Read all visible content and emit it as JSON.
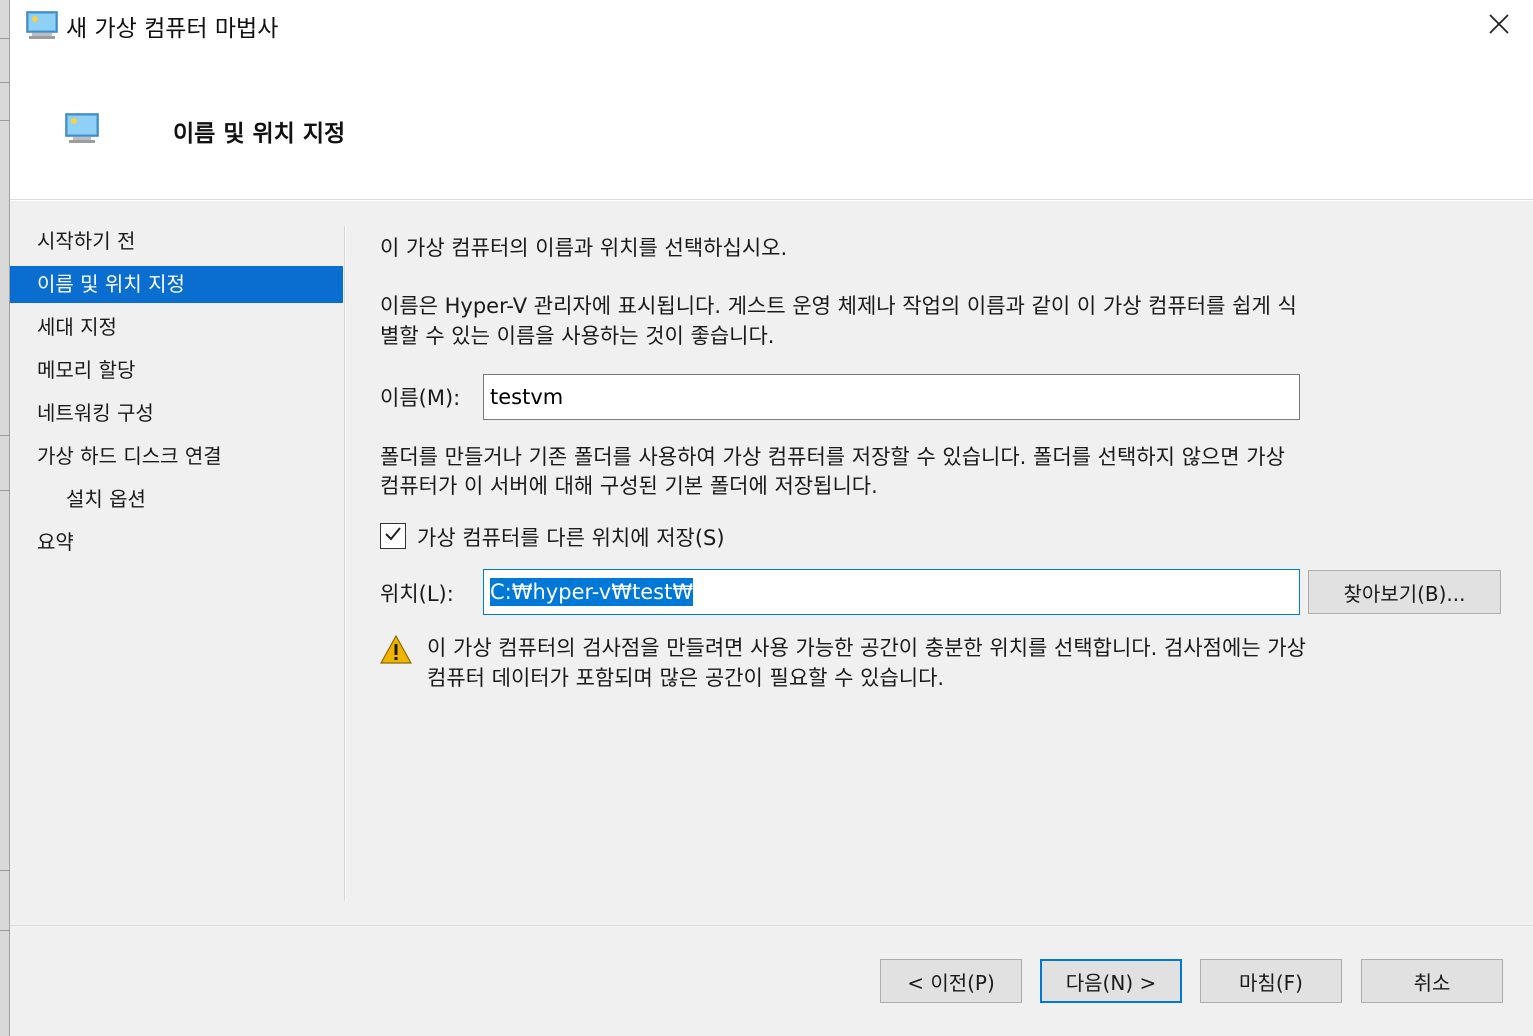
{
  "window": {
    "title": "새 가상 컴퓨터 마법사",
    "close_icon": "close-icon"
  },
  "header": {
    "title": "이름 및 위치 지정",
    "icon": "virtual-machine-icon"
  },
  "nav": {
    "items": [
      {
        "label": "시작하기 전"
      },
      {
        "label": "이름 및 위치 지정"
      },
      {
        "label": "세대 지정"
      },
      {
        "label": "메모리 할당"
      },
      {
        "label": "네트워킹 구성"
      },
      {
        "label": "가상 하드 디스크 연결"
      },
      {
        "label": "설치 옵션"
      },
      {
        "label": "요약"
      }
    ],
    "active_index": 1
  },
  "content": {
    "intro": "이 가상 컴퓨터의 이름과 위치를 선택하십시오.",
    "name_desc_line1": "이름은 Hyper-V 관리자에 표시됩니다. 게스트 운영 체제나 작업의 이름과 같이 이 가상 컴퓨터를 쉽게 식",
    "name_desc_line2": "별할 수 있는 이름을 사용하는 것이 좋습니다.",
    "name_label": "이름(M):",
    "name_value": "testvm",
    "folder_desc_line1": "폴더를 만들거나 기존 폴더를 사용하여 가상 컴퓨터를 저장할 수 있습니다. 폴더를 선택하지 않으면 가상",
    "folder_desc_line2": "컴퓨터가 이 서버에 대해 구성된 기본 폴더에 저장됩니다.",
    "store_checkbox_label": "가상 컴퓨터를 다른 위치에 저장(S)",
    "store_checked": true,
    "location_label": "위치(L):",
    "location_value": "C:₩hyper-v₩test₩",
    "browse_label": "찾아보기(B)...",
    "warning_line1": "이 가상 컴퓨터의 검사점을 만들려면 사용 가능한 공간이 충분한 위치를 선택합니다. 검사점에는 가상",
    "warning_line2": "컴퓨터 데이터가 포함되며 많은 공간이 필요할 수 있습니다.",
    "warning_icon": "warning-icon"
  },
  "footer": {
    "prev_label": "< 이전(P)",
    "next_label": "다음(N) >",
    "finish_label": "마침(F)",
    "cancel_label": "취소"
  },
  "colors": {
    "accent": "#0078d7",
    "nav_active": "#0a6ed1",
    "body_bg": "#f0f0f0",
    "warning": "#f0b400"
  }
}
